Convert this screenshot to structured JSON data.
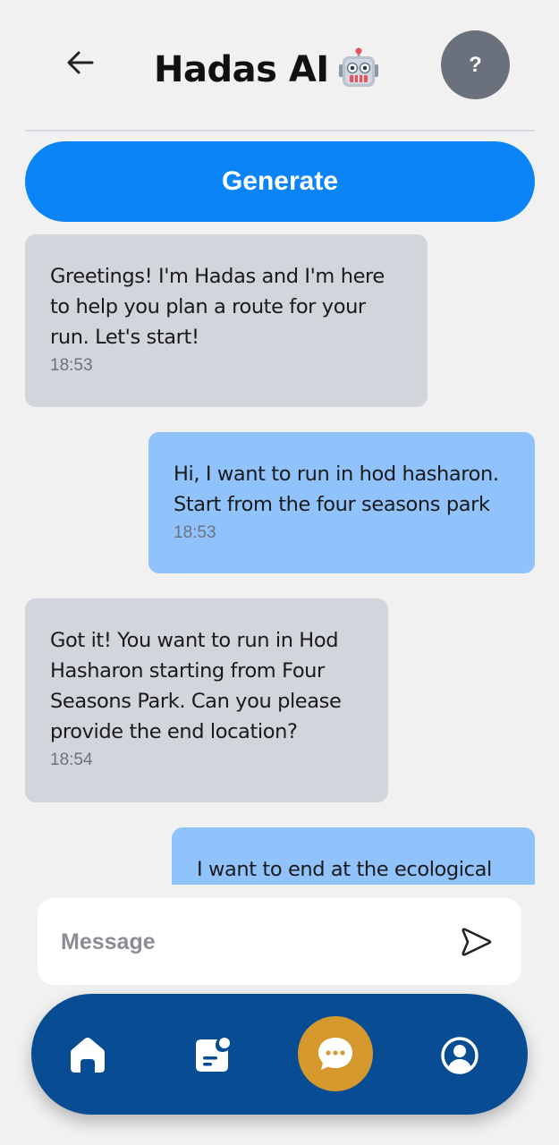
{
  "header": {
    "title": "Hadas AI",
    "back_icon": "arrow-left-icon",
    "title_icon": "robot-emoji-icon",
    "help_label": "?"
  },
  "actions": {
    "generate_label": "Generate"
  },
  "messages": [
    {
      "sender": "ai",
      "text": "Greetings! I'm Hadas and I'm here to help you plan a route for your run. Let's start!",
      "time": "18:53"
    },
    {
      "sender": "user",
      "text": "Hi, I want to run in hod hasharon. Start from the four seasons park",
      "time": "18:53"
    },
    {
      "sender": "ai",
      "text": "Got it! You want to run in Hod Hasharon starting from Four Seasons Park. Can you please provide the end location?",
      "time": "18:54"
    },
    {
      "sender": "user",
      "text": "I want to end at the ecological",
      "time": ""
    }
  ],
  "composer": {
    "placeholder": "Message",
    "value": "",
    "send_icon": "send-icon"
  },
  "nav": {
    "items": [
      {
        "icon": "home-icon",
        "active": false
      },
      {
        "icon": "notes-icon",
        "active": false
      },
      {
        "icon": "chat-icon",
        "active": true
      },
      {
        "icon": "profile-icon",
        "active": false
      }
    ]
  },
  "colors": {
    "background": "#f1f1f2",
    "primary": "#0a84f6",
    "ai_bubble": "#d2d5dc",
    "user_bubble": "#90c3fc",
    "nav_bar": "#084d93",
    "nav_active": "#d4982c",
    "help_button": "#6b717c"
  }
}
